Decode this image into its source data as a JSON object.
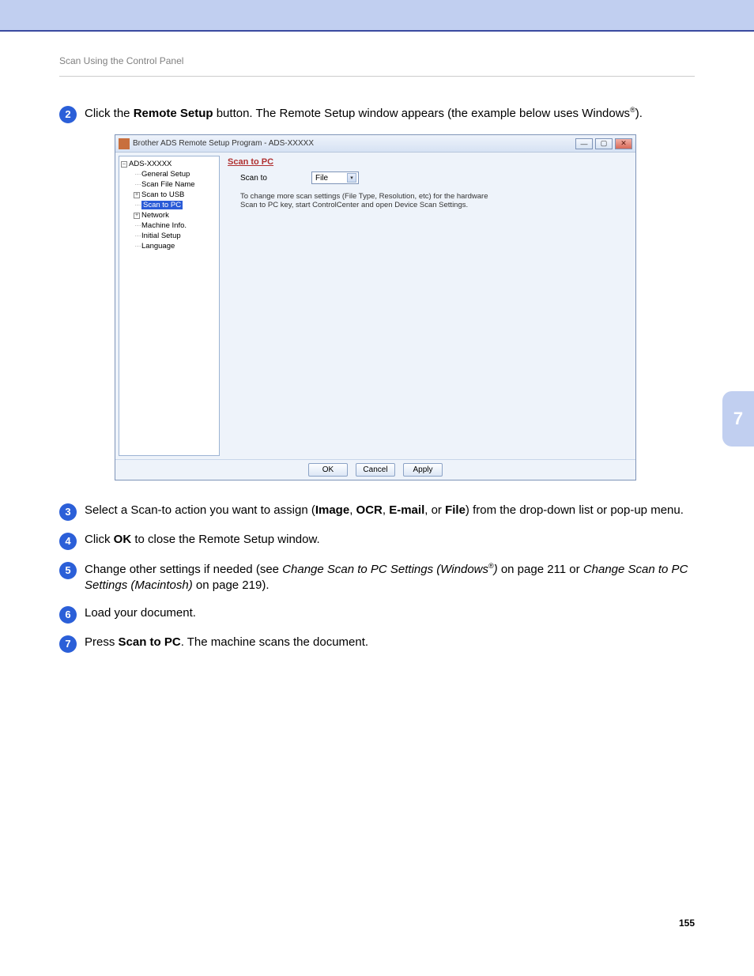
{
  "header": "Scan Using the Control Panel",
  "chapter_tab": "7",
  "page_number": "155",
  "steps": {
    "s2": {
      "num": "2",
      "pre": "Click the ",
      "bold1": "Remote Setup",
      "post1": " button. The Remote Setup window appears (the example below uses Windows",
      "reg": "®",
      "post2": ")."
    },
    "s3": {
      "num": "3",
      "pre": "Select a Scan-to action you want to assign (",
      "b1": "Image",
      "sep1": ", ",
      "b2": "OCR",
      "sep2": ", ",
      "b3": "E-mail",
      "sep3": ", or ",
      "b4": "File",
      "post": ") from the drop-down list or pop-up menu."
    },
    "s4": {
      "num": "4",
      "pre": "Click ",
      "b1": "OK",
      "post": " to close the Remote Setup window."
    },
    "s5": {
      "num": "5",
      "pre": "Change other settings if needed (see ",
      "i1": "Change Scan to PC Settings (Windows",
      "reg": "®",
      "i1_close": ")",
      "mid": " on page 211 or ",
      "i2": "Change Scan to PC Settings (Macintosh)",
      "post": " on page 219)."
    },
    "s6": {
      "num": "6",
      "text": "Load your document."
    },
    "s7": {
      "num": "7",
      "pre": "Press ",
      "b1": "Scan to PC",
      "post": ". The machine scans the document."
    }
  },
  "window": {
    "title": "Brother ADS Remote Setup Program - ADS-XXXXX",
    "win_btns": {
      "min": "—",
      "max": "▢",
      "close": "✕"
    },
    "tree": {
      "root": "ADS-XXXXX",
      "items": [
        "General Setup",
        "Scan File Name",
        "Scan to USB",
        "Scan to PC",
        "Network",
        "Machine Info.",
        "Initial Setup",
        "Language"
      ],
      "root_box": "–",
      "plus_box": "+"
    },
    "panel": {
      "heading": "Scan to PC",
      "field_label": "Scan to",
      "dropdown_value": "File",
      "hint_line1": "To change more scan settings (File Type, Resolution, etc) for the hardware",
      "hint_line2": "Scan to PC key, start ControlCenter and open Device Scan Settings."
    },
    "buttons": {
      "ok": "OK",
      "cancel": "Cancel",
      "apply": "Apply"
    }
  }
}
